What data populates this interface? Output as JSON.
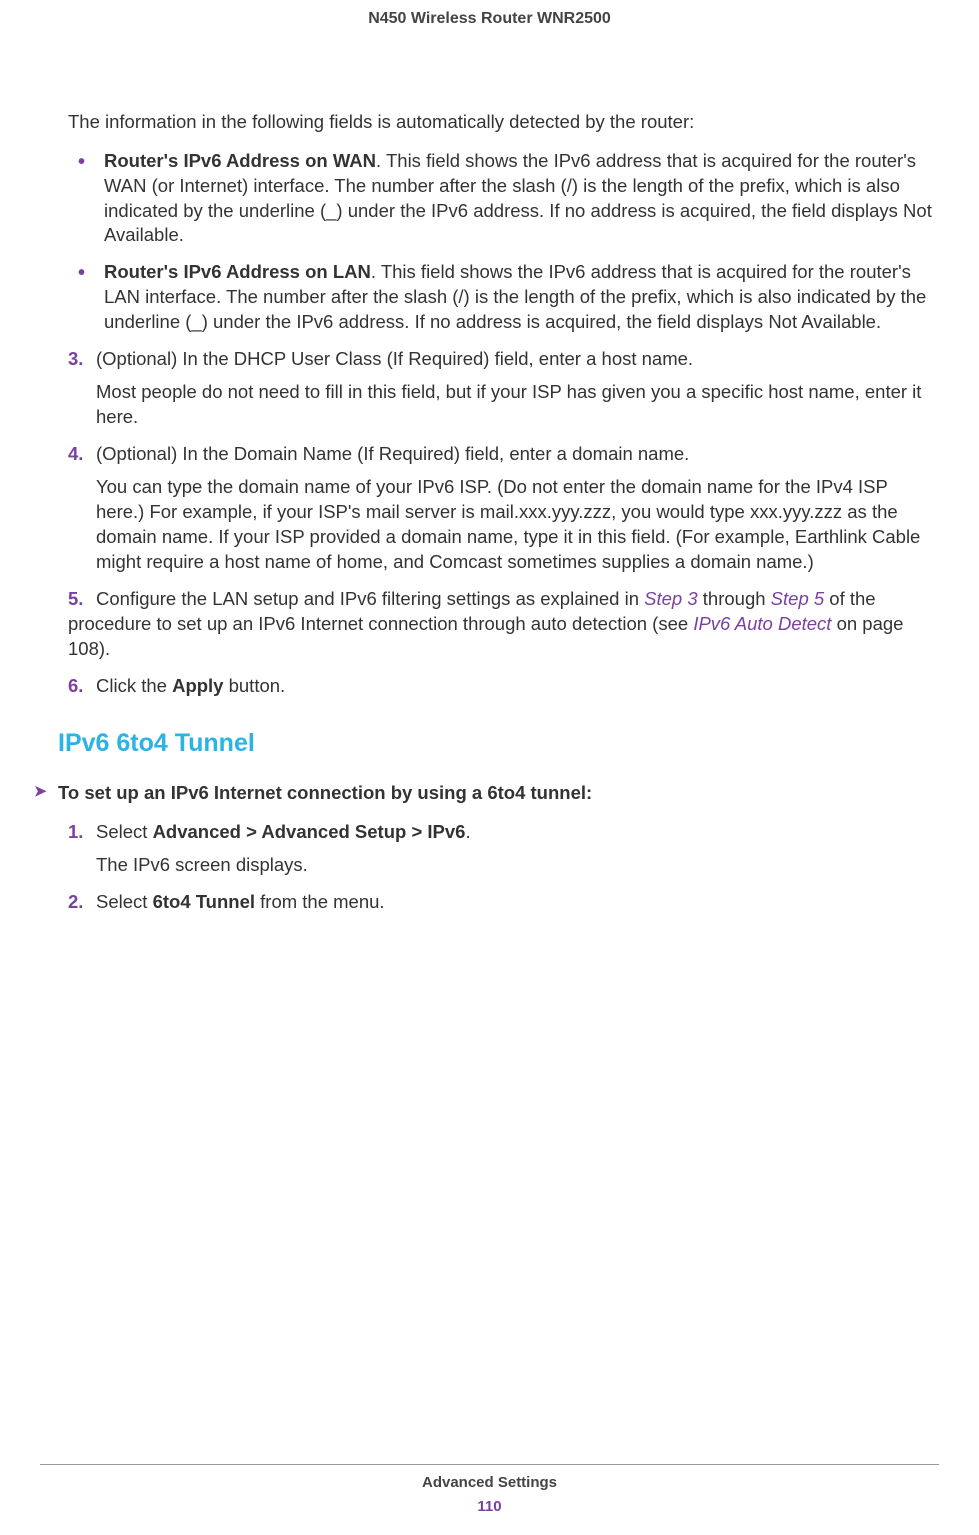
{
  "header": {
    "title": "N450 Wireless Router WNR2500"
  },
  "intro": "The information in the following fields is automatically detected by the router:",
  "bullets": [
    {
      "lead": "Router's IPv6 Address on WAN",
      "rest": ". This field shows the IPv6 address that is acquired for the router's WAN (or Internet) interface. The number after the slash (/) is the length of the prefix, which is also indicated by the underline (_) under the IPv6 address. If no address is acquired, the field displays Not Available."
    },
    {
      "lead": "Router's IPv6 Address on LAN",
      "rest": ". This field shows the IPv6 address that is acquired for the router's LAN interface. The number after the slash (/) is the length of the prefix, which is also indicated by the underline (_) under the IPv6 address. If no address is acquired, the field displays Not Available."
    }
  ],
  "steps_a": [
    {
      "num": "3.",
      "text": "(Optional) In the DHCP User Class (If Required) field, enter a host name.",
      "follow": "Most people do not need to fill in this field, but if your ISP has given you a specific host name, enter it here."
    },
    {
      "num": "4.",
      "text": "(Optional) In the Domain Name (If Required) field, enter a domain name.",
      "follow": "You can type the domain name of your IPv6 ISP. (Do not enter the domain name for the IPv4 ISP here.) For example, if your ISP's mail server is mail.xxx.yyy.zzz, you would type xxx.yyy.zzz as the domain name. If your ISP provided a domain name, type it in this field. (For example, Earthlink Cable might require a host name of home, and Comcast sometimes supplies a domain name.)"
    }
  ],
  "step5": {
    "num": "5.",
    "pre": "Configure the LAN setup and IPv6 filtering settings as explained in ",
    "link1": "Step 3",
    "mid1": " through ",
    "link2": "Step 5",
    "mid2": " of the procedure to set up an IPv6 Internet connection through auto detection (see  ",
    "link3": "IPv6 Auto Detect",
    "post": " on page 108)."
  },
  "step6": {
    "num": "6.",
    "pre": "Click the ",
    "bold": "Apply",
    "post": " button."
  },
  "section_heading": "IPv6 6to4 Tunnel",
  "task_heading": "To set up an IPv6 Internet connection by using a 6to4 tunnel:",
  "steps_b": [
    {
      "num": "1.",
      "pre": "Select ",
      "bold": "Advanced > Advanced Setup > IPv6",
      "post": ".",
      "follow": "The IPv6 screen displays."
    },
    {
      "num": "2.",
      "pre": "Select ",
      "bold": "6to4 Tunnel",
      "post": " from the menu."
    }
  ],
  "footer": {
    "section": "Advanced Settings",
    "page": "110"
  }
}
